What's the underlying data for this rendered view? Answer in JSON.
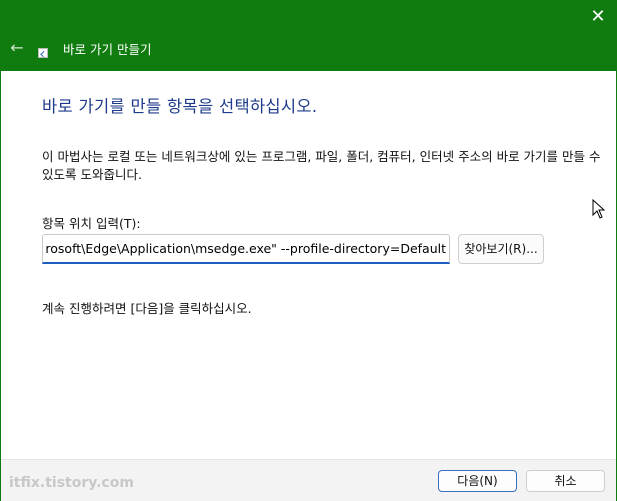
{
  "window": {
    "title": "바로 가기 만들기",
    "close_glyph": "✕",
    "back_glyph": "←"
  },
  "main": {
    "heading": "바로 가기를 만들 항목을 선택하십시오.",
    "description": "이 마법사는 로컬 또는 네트워크상에 있는 프로그램, 파일, 폴더, 컴퓨터, 인터넷 주소의 바로 가기를 만들 수 있도록 도와줍니다.",
    "location_label": "항목 위치 입력(T):",
    "location_value": "rosoft\\Edge\\Application\\msedge.exe\" --profile-directory=Default",
    "browse_label": "찾아보기(R)...",
    "continue_text": "계속 진행하려면 [다음]을 클릭하십시오."
  },
  "footer": {
    "watermark": "itfix.tistory.com",
    "next_label": "다음(N)",
    "cancel_label": "취소"
  },
  "colors": {
    "titlebar": "#107c10",
    "heading": "#1e3a8a",
    "input_accent": "#1d5fc0"
  }
}
